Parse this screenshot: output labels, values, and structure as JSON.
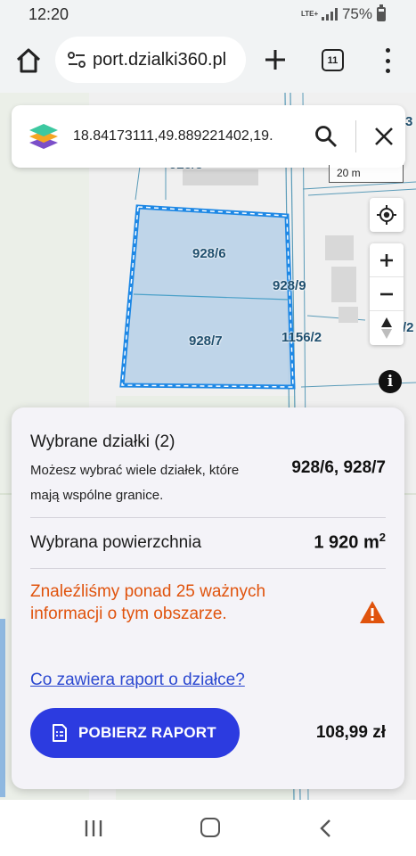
{
  "status_bar": {
    "time": "12:20",
    "network": "LTE+",
    "battery": "75%"
  },
  "browser": {
    "url": "port.dzialki360.pl",
    "tab_count": "11"
  },
  "search": {
    "value": "18.84173111,49.889221402,19."
  },
  "map": {
    "scale": "20 m",
    "parcels": [
      {
        "label": "928/3"
      },
      {
        "label": "928/6"
      },
      {
        "label": "928/9"
      },
      {
        "label": "928/7"
      },
      {
        "label": "1156/2"
      }
    ],
    "edge_labels": [
      "3",
      "/2"
    ],
    "selection_color": "#1e88e5",
    "fill_color": "#bcd3e8"
  },
  "panel": {
    "title": "Wybrane działki (2)",
    "description": "Możesz wybrać wiele działek, które mają wspólne granice.",
    "selected_parcels": "928/6, 928/7",
    "area_label": "Wybrana powierzchnia",
    "area_value": "1 920 m",
    "area_unit_exp": "2",
    "info_message": "Znaleźliśmy ponad 25 ważnych informacji o tym obszarze.",
    "report_link": "Co zawiera raport o działce?",
    "download_button": "POBIERZ RAPORT",
    "price": "108,99 zł",
    "accent_color": "#2c3be0",
    "warning_color": "#e0530d"
  }
}
